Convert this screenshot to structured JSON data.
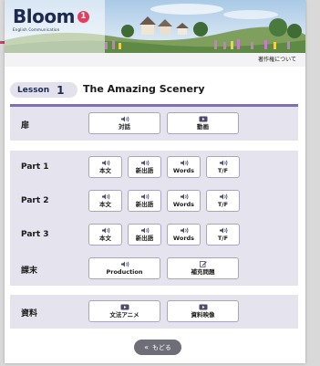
{
  "header": {
    "logo_text": "Bloom",
    "logo_badge": "1",
    "logo_subtitle": "English Communication",
    "copyright_link": "著作権について"
  },
  "lesson": {
    "label": "Lesson",
    "number": "1",
    "title": "The Amazing Scenery"
  },
  "rows": {
    "tobira": {
      "label": "扉",
      "buttons": [
        "対話",
        "動画"
      ]
    },
    "part1": {
      "label": "Part 1",
      "buttons": [
        "本文",
        "新出語",
        "Words",
        "T/F"
      ]
    },
    "part2": {
      "label": "Part 2",
      "buttons": [
        "本文",
        "新出語",
        "Words",
        "T/F"
      ]
    },
    "part3": {
      "label": "Part 3",
      "buttons": [
        "本文",
        "新出語",
        "Words",
        "T/F"
      ]
    },
    "katsumatsu": {
      "label": "課末",
      "buttons": [
        "Production",
        "補充問題"
      ]
    },
    "shiryo": {
      "label": "資料",
      "buttons": [
        "文法アニメ",
        "資料映像"
      ]
    }
  },
  "navigation": {
    "back_label": "もどる"
  },
  "icons": {
    "audio": "speaker-icon",
    "video": "play-icon",
    "edit": "edit-icon",
    "back": "double-chevron-left-icon"
  },
  "colors": {
    "row_background": "#e5e4ee",
    "accent_line": "#7d73a6",
    "logo_navy": "#1d2a4e",
    "badge_pink": "#e0405f",
    "back_button": "#6e6e78"
  }
}
